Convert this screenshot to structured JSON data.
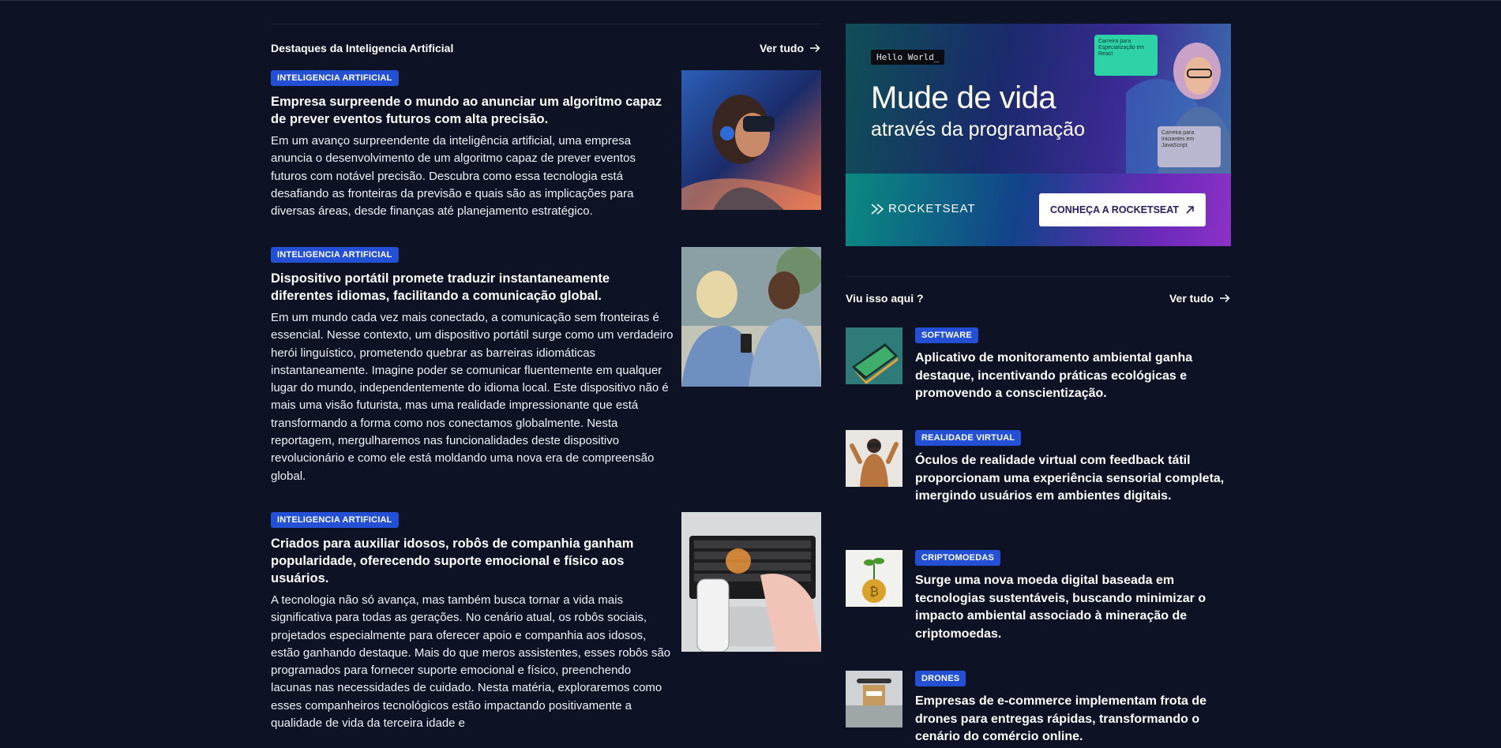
{
  "main": {
    "title": "Destaques da Inteligencia Artificial",
    "see_all": "Ver tudo",
    "articles": [
      {
        "category": "INTELIGENCIA ARTIFICIAL",
        "title": "Empresa surpreende o mundo ao anunciar um algoritmo capaz de prever eventos futuros com alta precisão.",
        "body": "Em um avanço surpreendente da inteligência artificial, uma empresa anuncia o desenvolvimento de um algoritmo capaz de prever eventos futuros com notável precisão. Descubra como essa tecnologia está desafiando as fronteiras da previsão e quais são as implicações para diversas áreas, desde finanças até planejamento estratégico."
      },
      {
        "category": "INTELIGENCIA ARTIFICIAL",
        "title": "Dispositivo portátil promete traduzir instantaneamente diferentes idiomas, facilitando a comunicação global.",
        "body": "Em um mundo cada vez mais conectado, a comunicação sem fronteiras é essencial. Nesse contexto, um dispositivo portátil surge como um verdadeiro herói linguístico, prometendo quebrar as barreiras idiomáticas instantaneamente. Imagine poder se comunicar fluentemente em qualquer lugar do mundo, independentemente do idioma local. Este dispositivo não é mais uma visão futurista, mas uma realidade impressionante que está transformando a forma como nos conectamos globalmente. Nesta reportagem, mergulharemos nas funcionalidades deste dispositivo revolucionário e como ele está moldando uma nova era de compreensão global."
      },
      {
        "category": "INTELIGENCIA ARTIFICIAL",
        "title": "Criados para auxiliar idosos, robôs de companhia ganham popularidade, oferecendo suporte emocional e físico aos usuários.",
        "body": "A tecnologia não só avança, mas também busca tornar a vida mais significativa para todas as gerações. No cenário atual, os robôs sociais, projetados especialmente para oferecer apoio e companhia aos idosos, estão ganhando destaque. Mais do que meros assistentes, esses robôs são programados para fornecer suporte emocional e físico, preenchendo lacunas nas necessidades de cuidado. Nesta matéria, exploraremos como esses companheiros tecnológicos estão impactando positivamente a qualidade de vida da terceira idade e"
      }
    ]
  },
  "ad": {
    "hello": "Hello World_",
    "headline": "Mude de vida",
    "subheadline": "através da programação",
    "card1": "Carreira para Especialização em React",
    "card2": "Carreira para Iniciantes em JavaScript",
    "brand": "ROCKETSEAT",
    "cta": "CONHEÇA A ROCKETSEAT"
  },
  "side": {
    "title": "Viu isso aqui ?",
    "see_all": "Ver tudo",
    "items": [
      {
        "category": "SOFTWARE",
        "title": "Aplicativo de monitoramento ambiental ganha destaque, incentivando práticas ecológicas e promovendo a conscientização."
      },
      {
        "category": "REALIDADE VIRTUAL",
        "title": "Óculos de realidade virtual com feedback tátil proporcionam uma experiência sensorial completa, imergindo usuários em ambientes digitais."
      },
      {
        "category": "CRIPTOMOEDAS",
        "title": "Surge uma nova moeda digital baseada em tecnologias sustentáveis, buscando minimizar o impacto ambiental associado à mineração de criptomoedas."
      },
      {
        "category": "DRONES",
        "title": "Empresas de e-commerce implementam frota de drones para entregas rápidas, transformando o cenário do comércio online."
      }
    ]
  },
  "colors": {
    "background": "#0d1224",
    "badge": "#2450d6"
  }
}
